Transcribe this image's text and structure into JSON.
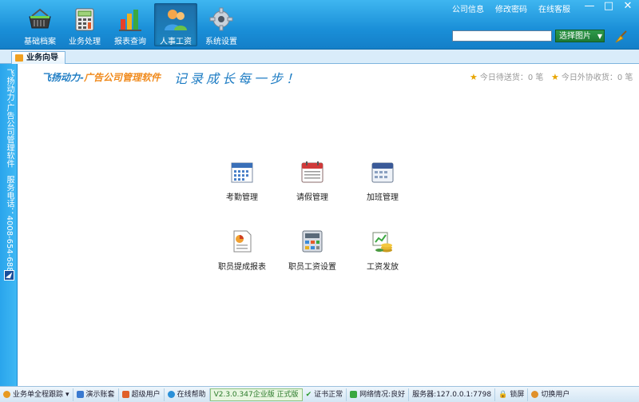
{
  "top_links": [
    "公司信息",
    "修改密码",
    "在线客服"
  ],
  "window_controls": {
    "minimize": "—",
    "maximize": "□",
    "close": "✕"
  },
  "toolbar": {
    "items": [
      {
        "label": "基础档案",
        "icon": "basket-icon"
      },
      {
        "label": "业务处理",
        "icon": "calculator-icon"
      },
      {
        "label": "报表查询",
        "icon": "bar-chart-icon"
      },
      {
        "label": "人事工资",
        "icon": "users-icon",
        "active": true
      },
      {
        "label": "系统设置",
        "icon": "gear-icon"
      }
    ]
  },
  "image_picker": {
    "label": "选择图片",
    "search_value": ""
  },
  "tab": {
    "label": "业务向导"
  },
  "sidebar": {
    "text": "飞扬动力-广告公司管理软件　服务电话：4008-654-688"
  },
  "brand": {
    "part1": "飞扬动力-",
    "part2": "广告公司管理软件"
  },
  "slogan": "记录成长每一步！",
  "status": {
    "pending_send": "今日待送货：0 笔",
    "outsourced": "今日外协收货：0 笔"
  },
  "functions": [
    {
      "label": "考勤管理",
      "icon": "attendance-calendar-icon"
    },
    {
      "label": "请假管理",
      "icon": "leave-calendar-icon"
    },
    {
      "label": "加班管理",
      "icon": "overtime-calendar-icon"
    },
    {
      "label": "职员提成报表",
      "icon": "commission-report-icon"
    },
    {
      "label": "职员工资设置",
      "icon": "salary-settings-icon"
    },
    {
      "label": "工资发放",
      "icon": "salary-payment-icon"
    }
  ],
  "statusbar": {
    "tracking": "业务单全程跟踪",
    "demo": "演示账套",
    "user": "超级用户",
    "help": "在线帮助",
    "version": "V2.3.0.347企业版 正式版",
    "cert": "证书正常",
    "network": "网络情况:良好",
    "server": "服务器:127.0.0.1:7798",
    "lock": "锁屏",
    "switch_user": "切换用户"
  }
}
